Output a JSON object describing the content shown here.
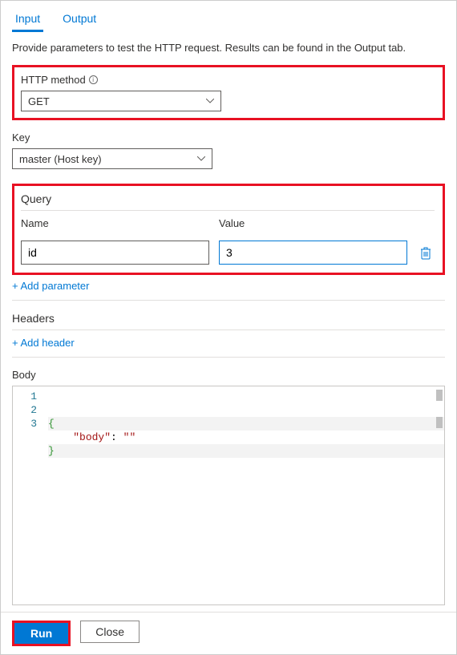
{
  "tabs": {
    "input": "Input",
    "output": "Output"
  },
  "description": "Provide parameters to test the HTTP request. Results can be found in the Output tab.",
  "http_method": {
    "label": "HTTP method",
    "value": "GET"
  },
  "key": {
    "label": "Key",
    "value": "master (Host key)"
  },
  "query": {
    "title": "Query",
    "name_label": "Name",
    "value_label": "Value",
    "rows": [
      {
        "name": "id",
        "value": "3"
      }
    ],
    "add_link": "+ Add parameter"
  },
  "headers": {
    "title": "Headers",
    "add_link": "+ Add header"
  },
  "body": {
    "title": "Body",
    "lines": [
      "1",
      "2",
      "3"
    ],
    "code": {
      "l1": "{",
      "l2_key": "\"body\"",
      "l2_colon": ": ",
      "l2_val": "\"\"",
      "l3": "}"
    }
  },
  "footer": {
    "run": "Run",
    "close": "Close"
  }
}
